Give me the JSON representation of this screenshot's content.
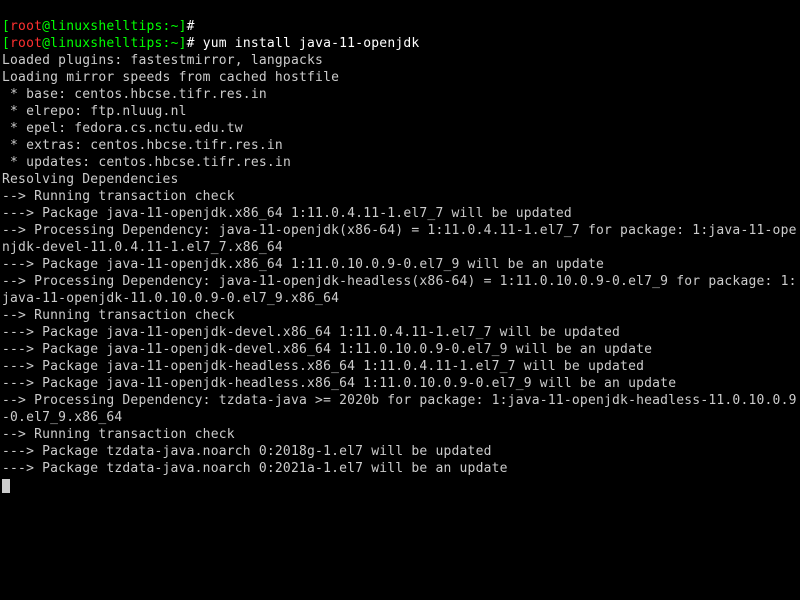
{
  "prompt": {
    "open": "[",
    "user": "root",
    "at": "@",
    "host": "linuxshelltips",
    "colon": ":",
    "cwd": "~",
    "close": "]",
    "hash": "#"
  },
  "commands": {
    "line1": "",
    "line2": "yum install java-11-openjdk"
  },
  "output": {
    "l01": "Loaded plugins: fastestmirror, langpacks",
    "l02": "Loading mirror speeds from cached hostfile",
    "l03": " * base: centos.hbcse.tifr.res.in",
    "l04": " * elrepo: ftp.nluug.nl",
    "l05": " * epel: fedora.cs.nctu.edu.tw",
    "l06": " * extras: centos.hbcse.tifr.res.in",
    "l07": " * updates: centos.hbcse.tifr.res.in",
    "l08": "Resolving Dependencies",
    "l09": "--> Running transaction check",
    "l10": "---> Package java-11-openjdk.x86_64 1:11.0.4.11-1.el7_7 will be updated",
    "l11": "--> Processing Dependency: java-11-openjdk(x86-64) = 1:11.0.4.11-1.el7_7 for package: 1:java-11-openjdk-devel-11.0.4.11-1.el7_7.x86_64",
    "l12": "---> Package java-11-openjdk.x86_64 1:11.0.10.0.9-0.el7_9 will be an update",
    "l13": "--> Processing Dependency: java-11-openjdk-headless(x86-64) = 1:11.0.10.0.9-0.el7_9 for package: 1:java-11-openjdk-11.0.10.0.9-0.el7_9.x86_64",
    "l14": "--> Running transaction check",
    "l15": "---> Package java-11-openjdk-devel.x86_64 1:11.0.4.11-1.el7_7 will be updated",
    "l16": "---> Package java-11-openjdk-devel.x86_64 1:11.0.10.0.9-0.el7_9 will be an update",
    "l17": "---> Package java-11-openjdk-headless.x86_64 1:11.0.4.11-1.el7_7 will be updated",
    "l18": "---> Package java-11-openjdk-headless.x86_64 1:11.0.10.0.9-0.el7_9 will be an update",
    "l19": "--> Processing Dependency: tzdata-java >= 2020b for package: 1:java-11-openjdk-headless-11.0.10.0.9-0.el7_9.x86_64",
    "l20": "--> Running transaction check",
    "l21": "---> Package tzdata-java.noarch 0:2018g-1.el7 will be updated",
    "l22": "---> Package tzdata-java.noarch 0:2021a-1.el7 will be an update"
  }
}
